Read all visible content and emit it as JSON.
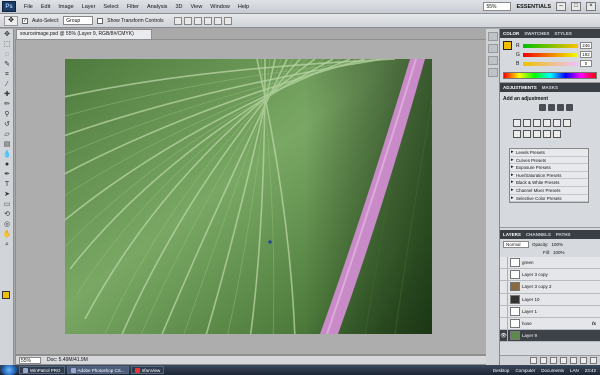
{
  "app": {
    "logo": "Ps"
  },
  "menu": [
    "File",
    "Edit",
    "Image",
    "Layer",
    "Select",
    "Filter",
    "Analysis",
    "3D",
    "View",
    "Window",
    "Help"
  ],
  "menubar_right": {
    "zoom": "55%",
    "workspace": "ESSENTIALS",
    "minimize": "–",
    "restore": "□",
    "close": "×"
  },
  "options": {
    "auto_select_label": "Auto-Select:",
    "auto_select_value": "Group",
    "show_transform_label": "Show Transform Controls"
  },
  "document": {
    "tab_title": "sourceimage.psd @ 55% (Layer 9, RGB/8#/CMYK)",
    "zoom": "55%",
    "doc_info": "Doc: 5.49M/41.9M"
  },
  "panels": {
    "color_tabs": [
      "COLOR",
      "SWATCHES",
      "STYLES"
    ],
    "color_values": {
      "R": "246",
      "G": "192",
      "B": "0"
    },
    "adjust_tabs": [
      "ADJUSTMENTS",
      "MASKS"
    ],
    "adjust_title": "Add an adjustment",
    "presets": [
      "Levels Presets",
      "Curves Presets",
      "Exposure Presets",
      "Hue/Saturation Presets",
      "Black & White Presets",
      "Channel Mixer Presets",
      "Selective Color Presets"
    ],
    "layer_tabs": [
      "LAYERS",
      "CHANNELS",
      "PATHS"
    ],
    "blend_mode": "Normal",
    "opacity_label": "Opacity:",
    "opacity_value": "100%",
    "fill_label": "Fill:",
    "fill_value": "100%",
    "layers": [
      {
        "name": "green",
        "fx": false,
        "active": false
      },
      {
        "name": "Layer 3 copy",
        "fx": false,
        "active": false
      },
      {
        "name": "Layer 3 copy 2",
        "fx": false,
        "active": false
      },
      {
        "name": "Layer 10",
        "fx": false,
        "active": false
      },
      {
        "name": "Layer 1",
        "fx": false,
        "active": false
      },
      {
        "name": "hose",
        "fx": true,
        "active": false
      },
      {
        "name": "Layer 9",
        "fx": false,
        "active": true
      }
    ]
  },
  "taskbar": {
    "items": [
      "WinPatrol PRO",
      "Adobe Photoshop CS...",
      "IrfanView"
    ],
    "right": [
      "Desktop",
      "Computer",
      "Documents",
      "LAN"
    ],
    "clock": "23:42"
  },
  "colors": {
    "foreground": "#f0c000",
    "leaf": "#5c8a4c",
    "vein": "#c98ac8"
  }
}
